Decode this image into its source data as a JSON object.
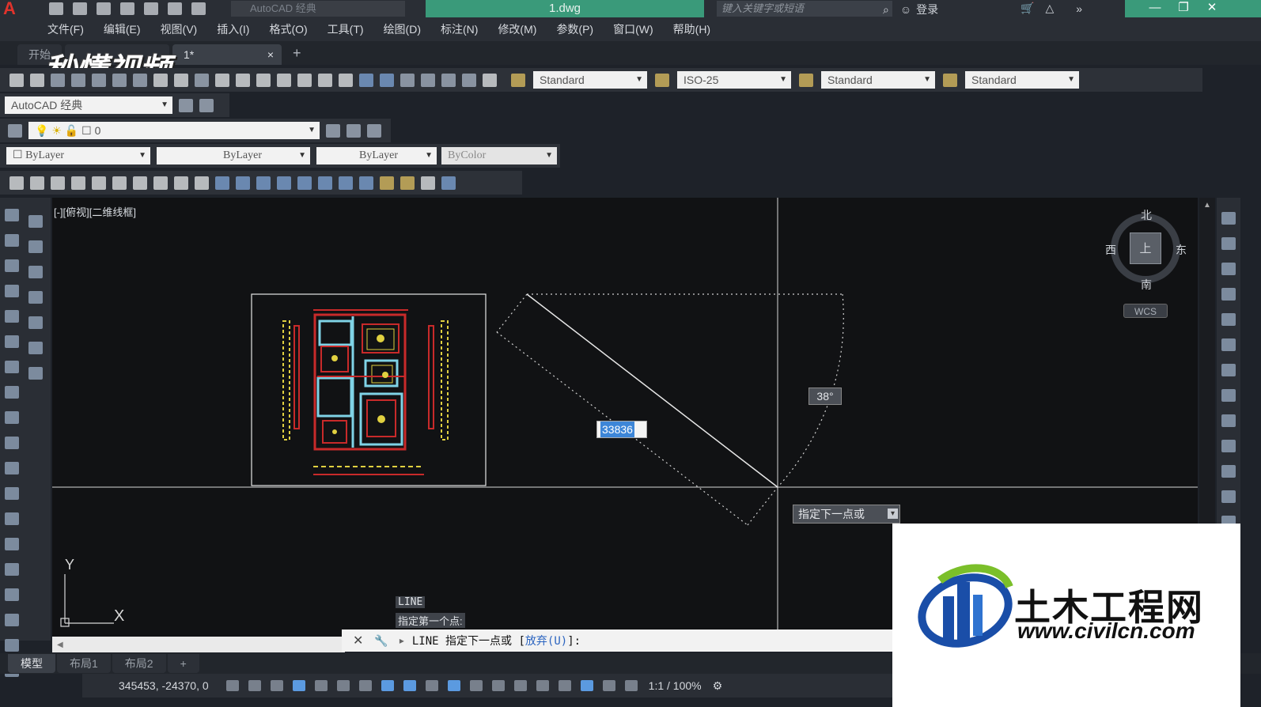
{
  "title_bar": {
    "app_combo": "AutoCAD 经典",
    "document": "1.dwg",
    "search_placeholder": "键入关键字或短语",
    "login": "登录",
    "minimize": "—",
    "restore": "❐",
    "close": "✕"
  },
  "menu": [
    "文件(F)",
    "编辑(E)",
    "视图(V)",
    "插入(I)",
    "格式(O)",
    "工具(T)",
    "绘图(D)",
    "标注(N)",
    "修改(M)",
    "参数(P)",
    "窗口(W)",
    "帮助(H)"
  ],
  "tabs": {
    "start": "开始",
    "drawing": "1*",
    "close_glyph": "×",
    "add": "+"
  },
  "styles": {
    "text_style": "Standard",
    "dim_style": "ISO-25",
    "table_style": "Standard",
    "mleader_style": "Standard"
  },
  "workspace": "AutoCAD 经典",
  "layer": "0",
  "properties": {
    "color": "ByLayer",
    "linetype": "ByLayer",
    "lineweight": "ByLayer",
    "plotstyle": "ByColor"
  },
  "viewport": {
    "label": "[-][俯视][二维线框]",
    "compass": {
      "north": "北",
      "south": "南",
      "east": "东",
      "west": "西",
      "top": "上"
    },
    "wcs": "WCS",
    "ucs_x": "X",
    "ucs_y": "Y"
  },
  "dynamic_input": {
    "length": "33836",
    "angle": "38°",
    "prompt": "指定下一点或"
  },
  "command": {
    "history_1": "LINE",
    "history_2": "指定第一个点:",
    "current_prefix": "LINE 指定下一点或 [",
    "current_option": "放弃(U)",
    "current_suffix": "]:"
  },
  "layout_tabs": [
    "模型",
    "布局1",
    "布局2",
    "+"
  ],
  "status": {
    "coords": "345453, -24370, 0",
    "scale": "1:1 / 100%"
  },
  "watermark": "秒懂视频",
  "logo": {
    "name": "土木工程网",
    "url": "www.civilcn.com"
  },
  "colors": {
    "title_accent": "#3a9a7a",
    "canvas": "#111214",
    "select_blue": "#3d86d8",
    "logo_blue": "#1a4ea8",
    "logo_green": "#7bbf2a"
  }
}
